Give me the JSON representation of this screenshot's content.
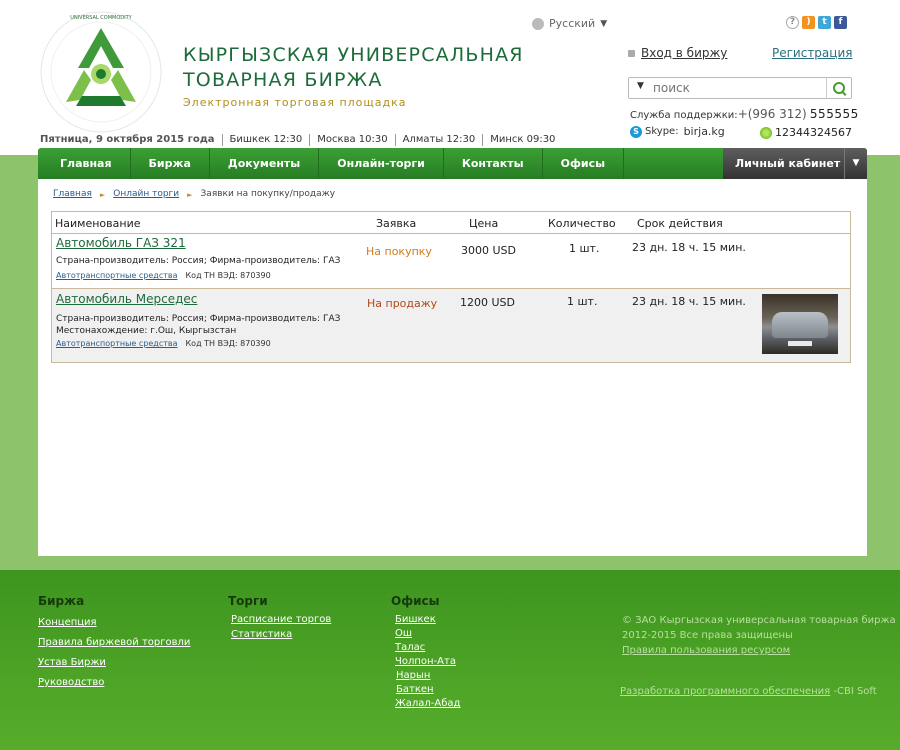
{
  "header": {
    "logo_alt": "The Kyrgyz Universal Commodity Exchange",
    "title_line1": "КЫРГЫЗСКАЯ УНИВЕРСАЛЬНАЯ",
    "title_line2": "ТОВАРНАЯ БИРЖА",
    "subtitle": "Электронная торговая площадка",
    "language": "Русский",
    "login_label": "Вход в биржу",
    "register_label": "Регистрация",
    "search_placeholder": "поиск",
    "support_label": "Служба поддержки:",
    "support_phone_code": "+(996 312)",
    "support_phone": "555555",
    "skype_label": "Skype:",
    "skype_id": "birja.kg",
    "icq_number": "12344324567",
    "date": "Пятница, 9 октября 2015 года",
    "times": [
      "Бишкек 12:30",
      "Москва 10:30",
      "Алматы 12:30",
      "Минск 09:30"
    ]
  },
  "nav": {
    "items": [
      "Главная",
      "Биржа",
      "Документы",
      "Онлайн-торги",
      "Контакты",
      "Офисы"
    ],
    "cabinet": "Личный кабинет"
  },
  "breadcrumb": {
    "items": [
      "Главная",
      "Онлайн торги",
      "Заявки на покупку/продажу"
    ]
  },
  "table": {
    "headers": {
      "name": "Наименование",
      "order": "Заявка",
      "price": "Цена",
      "qty": "Количество",
      "term": "Срок действия"
    },
    "rows": [
      {
        "name": "Автомобиль ГАЗ 321",
        "details": "Страна-производитель: Россия;   Фирма-производитель: ГАЗ",
        "location": "",
        "category": "Автотранспортные средства",
        "code": "Код ТН ВЭД: 870390",
        "order": "На покупку",
        "price": "3000 USD",
        "qty": "1 шт.",
        "term": "23 дн. 18 ч. 15 мин."
      },
      {
        "name": "Автомобиль Мерседес",
        "details": "Страна-производитель: Россия;   Фирма-производитель: ГАЗ",
        "location": "Местонахождение: г.Ош, Кыргызстан",
        "category": "Автотранспортные средства",
        "code": "Код ТН ВЭД: 870390",
        "order": "На продажу",
        "price": "1200 USD",
        "qty": "1 шт.",
        "term": "23 дн. 18 ч. 15 мин."
      }
    ]
  },
  "footer": {
    "birzha": {
      "title": "Биржа",
      "links": [
        "Концепция",
        "Правила биржевой торговли",
        "Устав Биржи",
        "Руководство"
      ]
    },
    "torgi": {
      "title": "Торги",
      "links": [
        "Расписание торгов",
        "Статистика"
      ]
    },
    "offices": {
      "title": "Офисы",
      "links": [
        "Бишкек",
        "Ош",
        "Талас",
        "Чолпон-Ата",
        "Нарын",
        "Баткен",
        "Жалал-Абад"
      ]
    },
    "copyright_line1": "© ЗАО Кыргызская универсальная товарная биржа",
    "copyright_line2": "2012-2015 Все права защищены",
    "terms_link": "Правила пользования ресурсом",
    "dev_link": "Разработка программного обеспечения",
    "dev_company": "-CBI Soft"
  },
  "colors": {
    "brand_green": "#267d23",
    "band_green": "#8cc36b",
    "title_green": "#1d6b3a",
    "accent_gold": "#b08f1a"
  }
}
